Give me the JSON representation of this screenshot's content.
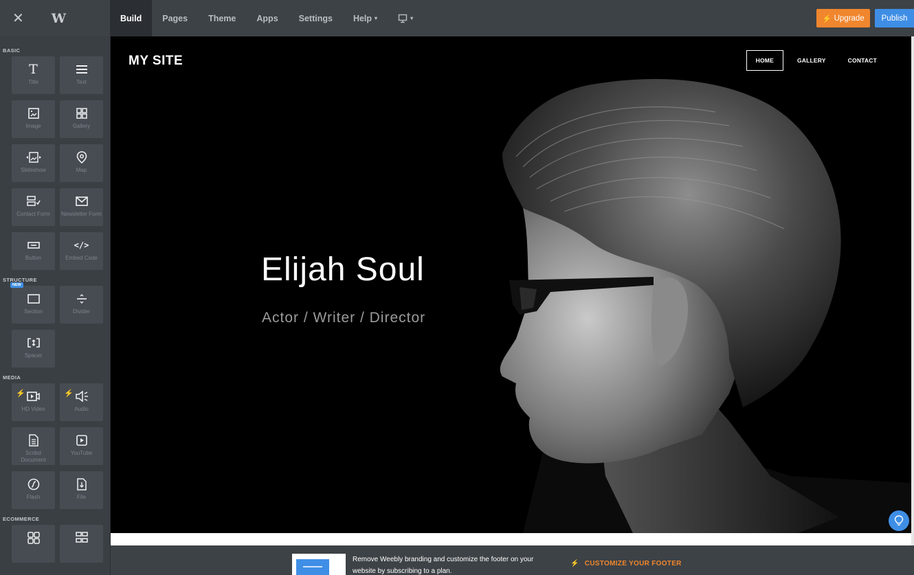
{
  "topbar": {
    "close_icon": "close-icon",
    "logo_text": "W",
    "tabs": [
      {
        "label": "Build",
        "active": true
      },
      {
        "label": "Pages"
      },
      {
        "label": "Theme"
      },
      {
        "label": "Apps"
      },
      {
        "label": "Settings"
      },
      {
        "label": "Help"
      }
    ],
    "upgrade_label": "Upgrade",
    "publish_label": "Publish"
  },
  "sidebar": {
    "sections": {
      "basic": "BASIC",
      "structure": "STRUCTURE",
      "media": "MEDIA",
      "ecommerce": "ECOMMERCE"
    },
    "basic": [
      {
        "label": "Title",
        "icon": "title-icon"
      },
      {
        "label": "Text",
        "icon": "text-icon"
      },
      {
        "label": "Image",
        "icon": "image-icon"
      },
      {
        "label": "Gallery",
        "icon": "gallery-icon"
      },
      {
        "label": "Slideshow",
        "icon": "slideshow-icon"
      },
      {
        "label": "Map",
        "icon": "map-pin-icon"
      },
      {
        "label": "Contact Form",
        "icon": "contact-form-icon"
      },
      {
        "label": "Newsletter Form",
        "icon": "envelope-icon"
      },
      {
        "label": "Button",
        "icon": "button-icon"
      },
      {
        "label": "Embed Code",
        "icon": "code-icon"
      }
    ],
    "structure": [
      {
        "label": "Section",
        "icon": "section-icon",
        "badge": "NEW"
      },
      {
        "label": "Divider",
        "icon": "divider-icon"
      },
      {
        "label": "Spacer",
        "icon": "spacer-icon"
      }
    ],
    "media": [
      {
        "label": "HD Video",
        "icon": "video-icon",
        "premium": true
      },
      {
        "label": "Audio",
        "icon": "audio-icon",
        "premium": true
      },
      {
        "label": "Scribd Document",
        "icon": "document-icon"
      },
      {
        "label": "YouTube",
        "icon": "youtube-icon"
      },
      {
        "label": "Flash",
        "icon": "flash-icon"
      },
      {
        "label": "File",
        "icon": "file-icon"
      }
    ]
  },
  "site": {
    "title": "MY SITE",
    "nav": [
      {
        "label": "HOME",
        "active": true
      },
      {
        "label": "GALLERY"
      },
      {
        "label": "CONTACT"
      }
    ],
    "hero_name": "Elijah Soul",
    "hero_subtitle": "Actor / Writer / Director"
  },
  "footer": {
    "message": "Remove Weebly branding and customize the footer on your website by subscribing to a plan.",
    "cta": "CUSTOMIZE YOUR FOOTER"
  },
  "colors": {
    "topbar": "#3d4246",
    "sidebar": "#3a3f44",
    "tile": "#474c52",
    "upgrade": "#f0862e",
    "publish": "#3f8ee6"
  }
}
